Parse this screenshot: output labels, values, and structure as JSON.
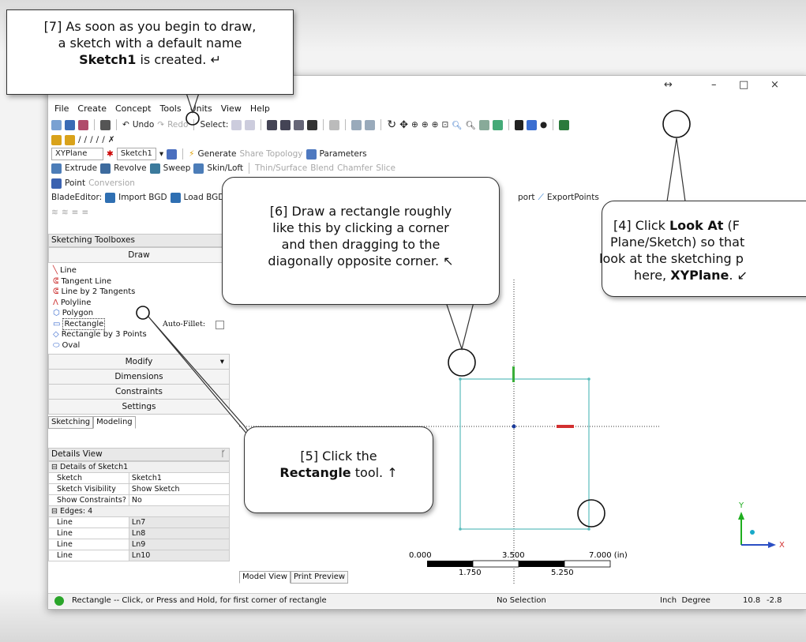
{
  "window": {
    "title_controls": [
      "↔",
      "–",
      "□",
      "×"
    ]
  },
  "menu": [
    "File",
    "Create",
    "Concept",
    "Tools",
    "Units",
    "View",
    "Help"
  ],
  "toolbar1": {
    "undo": "Undo",
    "redo": "Redo",
    "select": "Select:"
  },
  "toolbar3": {
    "plane": "XYPlane",
    "sketch": "Sketch1",
    "generate": "Generate",
    "share_topology": "Share Topology",
    "parameters": "Parameters"
  },
  "toolbar4": {
    "extrude": "Extrude",
    "revolve": "Revolve",
    "sweep": "Sweep",
    "skin_loft": "Skin/Loft",
    "thin_surface": "Thin/Surface",
    "blend": "Blend",
    "chamfer": "Chamfer",
    "slice": "Slice"
  },
  "toolbar5": {
    "point": "Point",
    "conversion": "Conversion"
  },
  "toolbar6": {
    "blade_editor": "BladeEditor:",
    "import_bgd": "Import BGD",
    "load_bgd": "Load BGD",
    "export": "port",
    "export_points": "ExportPoints"
  },
  "sketching_toolboxes": {
    "header": "Sketching Toolboxes",
    "draw": "Draw",
    "tools": [
      "Line",
      "Tangent Line",
      "Line by 2 Tangents",
      "Polyline",
      "Polygon",
      "Rectangle",
      "Rectangle by 3 Points",
      "Oval"
    ],
    "auto_fillet": "Auto-Fillet:",
    "sections": [
      "Modify",
      "Dimensions",
      "Constraints",
      "Settings"
    ],
    "tabs": [
      "Sketching",
      "Modeling"
    ]
  },
  "details": {
    "header": "Details View",
    "group1": "Details of Sketch1",
    "rows1": [
      [
        "Sketch",
        "Sketch1"
      ],
      [
        "Sketch Visibility",
        "Show Sketch"
      ],
      [
        "Show Constraints?",
        "No"
      ]
    ],
    "group2": "Edges: 4",
    "rows2": [
      [
        "Line",
        "Ln7"
      ],
      [
        "Line",
        "Ln8"
      ],
      [
        "Line",
        "Ln9"
      ],
      [
        "Line",
        "Ln10"
      ]
    ]
  },
  "graphics": {
    "scale_labels": [
      "0.000",
      "3.500",
      "7.000 (in)",
      "1.750",
      "5.250"
    ],
    "axis_x": "X",
    "axis_y": "Y",
    "tabs": [
      "Model View",
      "Print Preview"
    ]
  },
  "status": {
    "message": "Rectangle -- Click, or Press and Hold, for first corner of rectangle",
    "selection": "No Selection",
    "units": "Inch  Degree",
    "coord1": "10.8",
    "coord2": "-2.8"
  },
  "callouts": {
    "c7_pre": "[7] As soon as you begin to draw,",
    "c7_line2": "a sketch with a default name",
    "c7_bold": "Sketch1",
    "c7_post": "is created. ↵",
    "c6_line1": "[6] Draw a rectangle roughly",
    "c6_line2": "like this by clicking a corner",
    "c6_line3": "and then dragging to the",
    "c6_line4": "diagonally opposite corner. ↖",
    "c4_pre": "[4] Click",
    "c4_bold": "Look At",
    "c4_post": "(F",
    "c4_line2": "Plane/Sketch) so that",
    "c4_line3": "look at the sketching p",
    "c4_line4_pre": "here,",
    "c4_line4_bold": "XYPlane",
    "c4_line4_post": ". ↙",
    "c5_line1": "[5] Click the",
    "c5_bold": "Rectangle",
    "c5_post": "tool. ↑"
  }
}
